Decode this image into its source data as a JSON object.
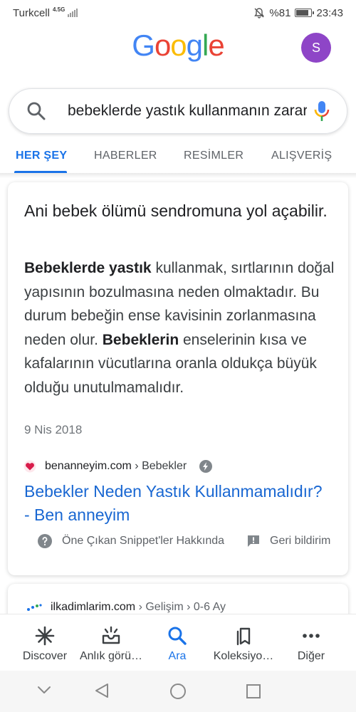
{
  "status_bar": {
    "carrier": "Turkcell",
    "network": "4.5G",
    "battery": "%81",
    "battery_level": 0.81,
    "time": "23:43"
  },
  "header": {
    "logo_letters": [
      "G",
      "o",
      "o",
      "g",
      "l",
      "e"
    ],
    "avatar_letter": "S"
  },
  "colors": {
    "google_blue": "#4285F4",
    "google_red": "#EA4335",
    "google_yellow": "#FBBC05",
    "google_green": "#34A853",
    "link": "#1967d2",
    "avatar": "#8e45c7"
  },
  "search": {
    "query": "bebeklerde yastık kullanmanın zararları",
    "icons": [
      "search-icon",
      "microphone-icon"
    ]
  },
  "tabs": [
    {
      "label": "HER ŞEY",
      "active": true
    },
    {
      "label": "HABERLER",
      "active": false
    },
    {
      "label": "RESİMLER",
      "active": false
    },
    {
      "label": "ALIŞVERİŞ",
      "active": false
    }
  ],
  "snippet": {
    "heading": "Ani bebek ölümü sendromuna yol açabilir.",
    "body_parts": [
      "Bebeklerde yastık",
      " kullanmak, sırtlarının doğal yapısının bozulmasına neden olmaktadır. Bu durum bebeğin ense kavisinin zorlanmasına neden olur. ",
      "Bebeklerin",
      " enselerinin kısa ve kafalarının vücutlarına oranla oldukça büyük olduğu unutulmamalıdır."
    ],
    "date": "9 Nis 2018",
    "source_site": "benanneyim.com",
    "source_path": " › Bebekler",
    "result_title": "Bebekler Neden Yastık Kullanmamalıdır? - Ben anneyim",
    "about_label": "Öne Çıkan Snippet'ler Hakkında",
    "feedback_label": "Geri bildirim"
  },
  "next_result": {
    "site": "ilkadimlarim.com",
    "path": " › Gelişim › 0-6 Ay"
  },
  "bottom_nav": [
    {
      "label": "Discover",
      "icon": "discover-icon",
      "active": false
    },
    {
      "label": "Anlık görü…",
      "icon": "updates-inbox-icon",
      "active": false
    },
    {
      "label": "Ara",
      "icon": "search-icon",
      "active": true
    },
    {
      "label": "Koleksiyo…",
      "icon": "collections-icon",
      "active": false
    },
    {
      "label": "Diğer",
      "icon": "more-icon",
      "active": false
    }
  ],
  "android_nav": [
    "chevron-down-icon",
    "back-icon",
    "home-icon",
    "recents-icon"
  ]
}
